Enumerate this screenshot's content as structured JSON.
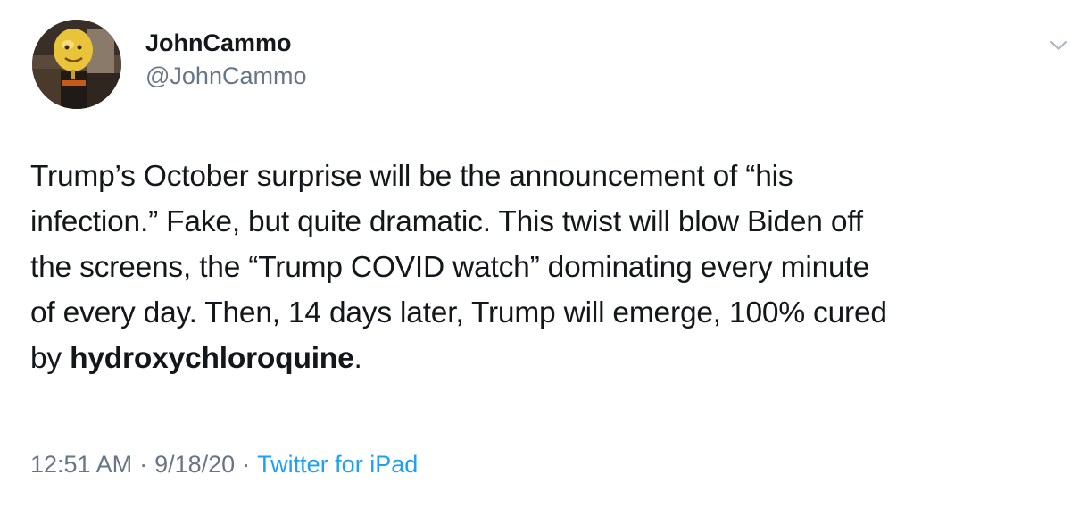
{
  "author": {
    "display_name": "JohnCammo",
    "handle": "@JohnCammo",
    "avatar_icon": "moon-face-avatar-icon"
  },
  "menu": {
    "icon": "chevron-down-icon"
  },
  "tweet": {
    "lines": [
      "Trump’s October surprise will be the announcement of “his",
      "infection.”  Fake, but quite dramatic. This twist will blow Biden off",
      "the screens, the “Trump COVID watch” dominating every minute",
      "of every day.  Then, 14 days later, Trump will emerge, 100% cured"
    ],
    "last_line_prefix": "by ",
    "last_line_bold": "hydroxychloroquine",
    "last_line_suffix": "."
  },
  "meta": {
    "time": "12:51 AM",
    "separator": "·",
    "date": "9/18/20",
    "source": "Twitter for iPad"
  },
  "colors": {
    "text": "#14171a",
    "secondary": "#657786",
    "link": "#1da1f2"
  }
}
